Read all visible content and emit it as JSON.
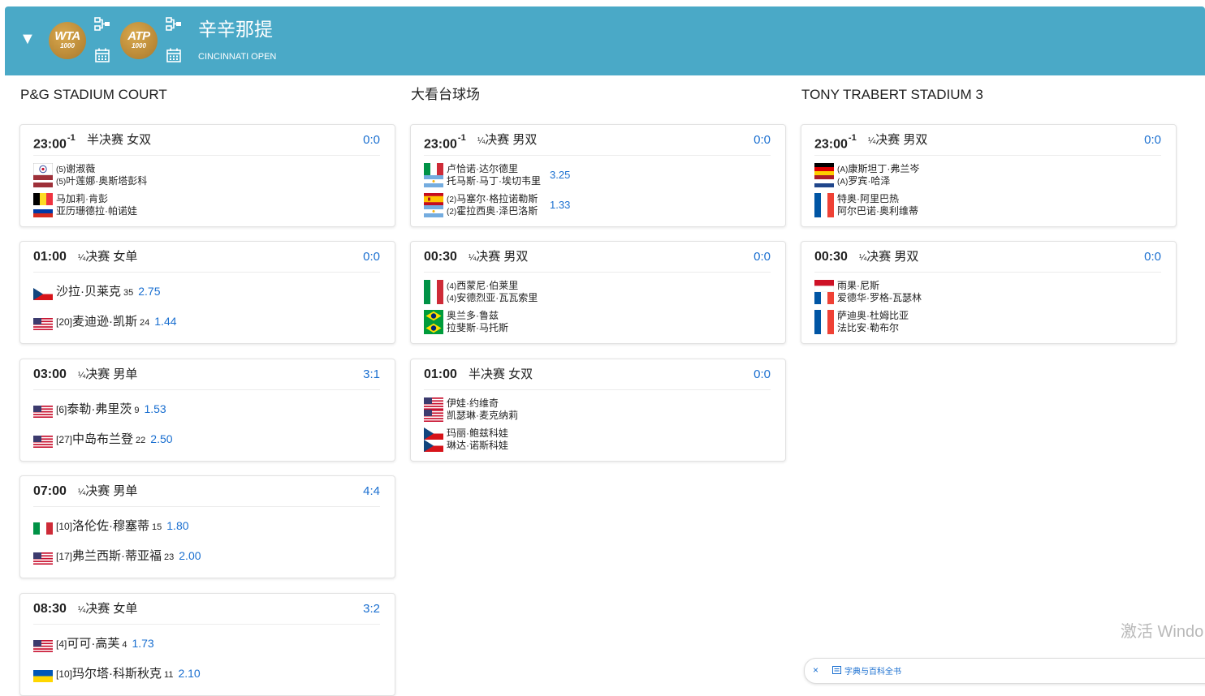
{
  "header": {
    "title": "辛辛那提",
    "subtitle": "CINCINNATI OPEN",
    "badges": [
      {
        "line1": "WTA",
        "line2": "1000"
      },
      {
        "line1": "ATP",
        "line2": "1000"
      }
    ],
    "icons": [
      "draw-bracket-icon",
      "calendar-icon"
    ]
  },
  "columns": [
    {
      "court": "P&G STADIUM COURT",
      "cards": [
        {
          "time": "23:00",
          "day": "-1",
          "round": "半决赛 女双",
          "score": "0:0",
          "type": "doubles",
          "sides": [
            {
              "players": [
                {
                  "flag": "tpe",
                  "seed": "(5)",
                  "name": "谢淑薇"
                },
                {
                  "flag": "lat",
                  "seed": "(5)",
                  "name": "叶莲娜·奥斯塔彭科"
                }
              ],
              "odds": ""
            },
            {
              "players": [
                {
                  "flag": "bel",
                  "seed": "",
                  "name": "马加莉·肯彭"
                },
                {
                  "flag": "rus",
                  "seed": "",
                  "name": "亚历珊德拉·帕诺娃"
                }
              ],
              "odds": ""
            }
          ]
        },
        {
          "time": "01:00",
          "day": "",
          "round_prefix": "¼",
          "round": "决赛 女单",
          "score": "0:0",
          "type": "singles",
          "sides": [
            {
              "flag": "cze",
              "seed": "",
              "name": "沙拉·贝莱克",
              "rank": "35",
              "odds": "2.75"
            },
            {
              "flag": "usa",
              "seed": "[20]",
              "name": "麦迪逊·凯斯",
              "rank": "24",
              "odds": "1.44"
            }
          ]
        },
        {
          "time": "03:00",
          "day": "",
          "round_prefix": "¼",
          "round": "决赛 男单",
          "score": "3:1",
          "type": "singles",
          "sides": [
            {
              "flag": "usa",
              "seed": "[6]",
              "name": "泰勒·弗里茨",
              "rank": "9",
              "odds": "1.53"
            },
            {
              "flag": "usa",
              "seed": "[27]",
              "name": "中岛布兰登",
              "rank": "22",
              "odds": "2.50"
            }
          ]
        },
        {
          "time": "07:00",
          "day": "",
          "round_prefix": "¼",
          "round": "决赛 男单",
          "score": "4:4",
          "type": "singles",
          "sides": [
            {
              "flag": "ita",
              "seed": "[10]",
              "name": "洛伦佐·穆塞蒂",
              "rank": "15",
              "odds": "1.80"
            },
            {
              "flag": "usa",
              "seed": "[17]",
              "name": "弗兰西斯·蒂亚福",
              "rank": "23",
              "odds": "2.00"
            }
          ]
        },
        {
          "time": "08:30",
          "day": "",
          "round_prefix": "¼",
          "round": "决赛 女单",
          "score": "3:2",
          "type": "singles",
          "sides": [
            {
              "flag": "usa",
              "seed": "[4]",
              "name": "可可·高芙",
              "rank": "4",
              "odds": "1.73"
            },
            {
              "flag": "ukr",
              "seed": "[10]",
              "name": "玛尔塔·科斯秋克",
              "rank": "11",
              "odds": "2.10"
            }
          ]
        }
      ]
    },
    {
      "court": "大看台球场",
      "cards": [
        {
          "time": "23:00",
          "day": "-1",
          "round_prefix": "¼",
          "round": "决赛 男双",
          "score": "0:0",
          "type": "doubles",
          "sides": [
            {
              "players": [
                {
                  "flag": "ita",
                  "seed": "",
                  "name": "卢恰诺·达尔德里"
                },
                {
                  "flag": "arg",
                  "seed": "",
                  "name": "托马斯·马丁·埃切韦里"
                }
              ],
              "odds": "3.25"
            },
            {
              "players": [
                {
                  "flag": "esp",
                  "seed": "(2)",
                  "name": "马塞尔·格拉诺勒斯"
                },
                {
                  "flag": "arg",
                  "seed": "(2)",
                  "name": "霍拉西奥·泽巴洛斯"
                }
              ],
              "odds": "1.33"
            }
          ]
        },
        {
          "time": "00:30",
          "day": "",
          "round_prefix": "¼",
          "round": "决赛 男双",
          "score": "0:0",
          "type": "doubles",
          "sides": [
            {
              "players": [
                {
                  "flag": "ita",
                  "seed": "(4)",
                  "name": "西蒙尼·伯莱里"
                },
                {
                  "flag": "ita",
                  "seed": "(4)",
                  "name": "安德烈亚·瓦瓦索里"
                }
              ],
              "odds": ""
            },
            {
              "players": [
                {
                  "flag": "bra",
                  "seed": "",
                  "name": "奥兰多·鲁兹"
                },
                {
                  "flag": "bra",
                  "seed": "",
                  "name": "拉斐斯·马托斯"
                }
              ],
              "odds": ""
            }
          ]
        },
        {
          "time": "01:00",
          "day": "",
          "round": "半决赛 女双",
          "score": "0:0",
          "type": "doubles",
          "sides": [
            {
              "players": [
                {
                  "flag": "usa",
                  "seed": "",
                  "name": "伊娃·约维奇"
                },
                {
                  "flag": "usa",
                  "seed": "",
                  "name": "凯瑟琳·麦克纳莉"
                }
              ],
              "odds": ""
            },
            {
              "players": [
                {
                  "flag": "cze",
                  "seed": "",
                  "name": "玛丽·鲍兹科娃"
                },
                {
                  "flag": "cze",
                  "seed": "",
                  "name": "琳达·诺斯科娃"
                }
              ],
              "odds": ""
            }
          ]
        }
      ]
    },
    {
      "court": "TONY TRABERT STADIUM 3",
      "cards": [
        {
          "time": "23:00",
          "day": "-1",
          "round_prefix": "¼",
          "round": "决赛 男双",
          "score": "0:0",
          "type": "doubles",
          "sides": [
            {
              "players": [
                {
                  "flag": "ger",
                  "seed": "(A)",
                  "name": "康斯坦丁·弗兰岑"
                },
                {
                  "flag": "ned",
                  "seed": "(A)",
                  "name": "罗宾·哈泽"
                }
              ],
              "odds": ""
            },
            {
              "players": [
                {
                  "flag": "fra",
                  "seed": "",
                  "name": "特奥·阿里巴热"
                },
                {
                  "flag": "fra",
                  "seed": "",
                  "name": "阿尔巴诺·奥利维蒂"
                }
              ],
              "odds": ""
            }
          ]
        },
        {
          "time": "00:30",
          "day": "",
          "round_prefix": "¼",
          "round": "决赛 男双",
          "score": "0:0",
          "type": "doubles",
          "sides": [
            {
              "players": [
                {
                  "flag": "mon",
                  "seed": "",
                  "name": "雨果·尼斯"
                },
                {
                  "flag": "fra",
                  "seed": "",
                  "name": "爱德华·罗格-瓦瑟林"
                }
              ],
              "odds": ""
            },
            {
              "players": [
                {
                  "flag": "fra",
                  "seed": "",
                  "name": "萨迪奥·杜姆比亚"
                },
                {
                  "flag": "fra",
                  "seed": "",
                  "name": "法比安·勒布尔"
                }
              ],
              "odds": ""
            }
          ]
        }
      ]
    }
  ],
  "overlay": {
    "watermark": "激活 Windo",
    "panel_close": "×",
    "panel_label": "字典与百科全书"
  },
  "colors": {
    "header_bg": "#4aa9c7",
    "score": "#1a6fd0",
    "badge_gold": "#c39342"
  }
}
